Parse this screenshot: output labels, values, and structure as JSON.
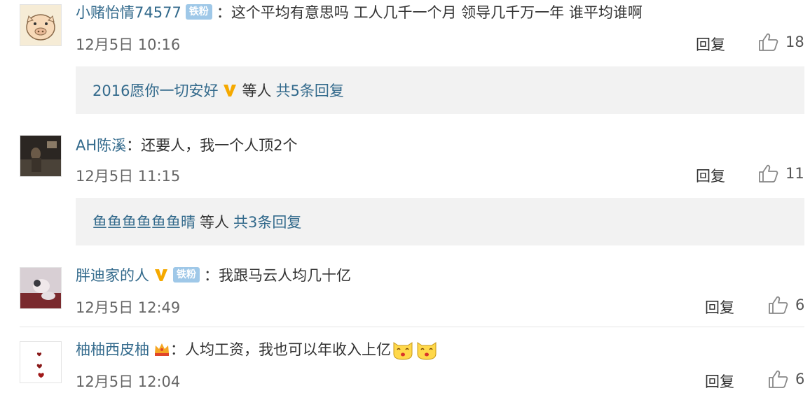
{
  "comments": [
    {
      "username": "小赌怡情74577",
      "fan_badge": "铁粉",
      "text": "这个平均有意思吗 工人几千一个月 领导几千万一年 谁平均谁啊",
      "time": "12月5日 10:16",
      "reply_label": "回复",
      "likes": "18",
      "sub": {
        "names": "2016愿你一切安好",
        "deng": "等人",
        "total": "共5条回复"
      }
    },
    {
      "username": "AH陈溪",
      "text": "还要人，我一个人顶2个",
      "time": "12月5日 11:15",
      "reply_label": "回复",
      "likes": "11",
      "sub": {
        "names": "鱼鱼鱼鱼鱼鱼晴",
        "deng": "等人",
        "total": "共3条回复"
      }
    },
    {
      "username": "胖迪家的人",
      "fan_badge": "铁粉",
      "text": "我跟马云人均几十亿",
      "time": "12月5日 12:49",
      "reply_label": "回复",
      "likes": "6"
    },
    {
      "username": "柚柚西皮柚",
      "text": "人均工资，我也可以年收入上亿",
      "time": "12月5日 12:04",
      "reply_label": "回复",
      "likes": "6"
    }
  ],
  "colors": {
    "username": "#336a8c",
    "sub_bg": "#f2f2f2",
    "fan_badge": "#9fc8e8",
    "vip": "#f5a900"
  },
  "icons": [
    "thumbs-up-icon",
    "vip-v-icon",
    "crown-icon",
    "cat-face-emoji"
  ]
}
